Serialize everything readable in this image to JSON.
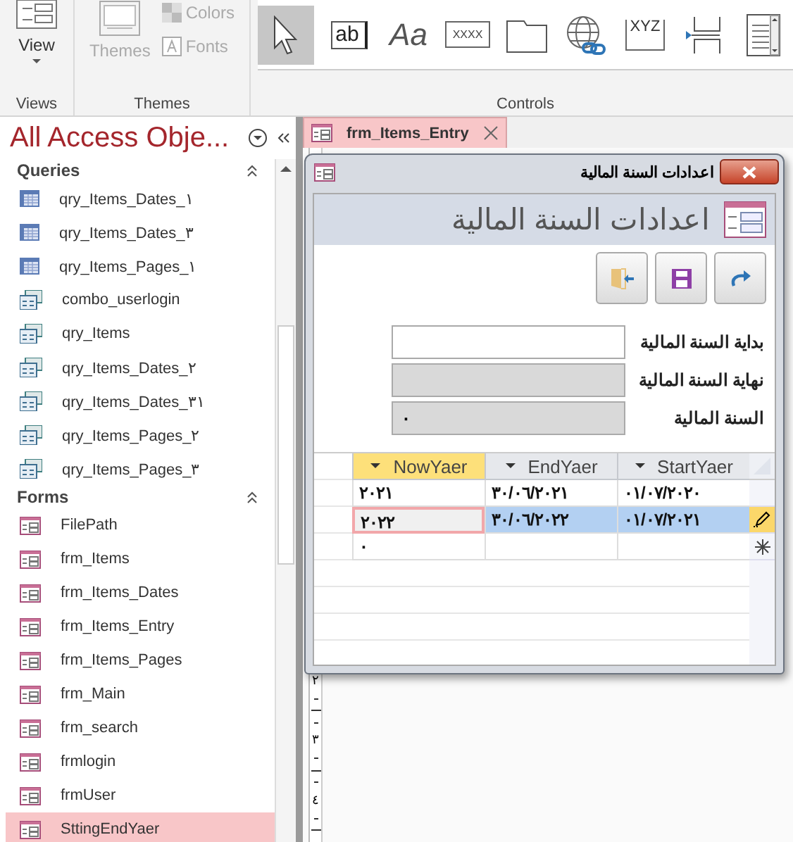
{
  "ribbon": {
    "views_group": {
      "label": "Views",
      "view_button": {
        "label": "View"
      }
    },
    "themes_group": {
      "label": "Themes",
      "themes_button": {
        "label": "Themes",
        "disabled": true
      },
      "colors_button": {
        "label": "Colors",
        "disabled": true
      },
      "fonts_button": {
        "label": "Fonts",
        "disabled": true
      }
    },
    "controls_group": {
      "label": "Controls",
      "tools": {
        "pointer": {
          "selected": true
        },
        "textbox": {
          "glyph": "ab",
          "selected": false
        },
        "label": {
          "glyph": "Aa",
          "selected": false
        },
        "button": {
          "glyph": "XXXX",
          "selected": false
        },
        "tab": {
          "selected": false
        },
        "hyperlink": {
          "selected": false
        },
        "frame": {
          "glyph": "XYZ",
          "selected": false
        },
        "pagebreak": {
          "selected": false
        },
        "listbox": {
          "selected": false
        }
      }
    }
  },
  "nav": {
    "title": "All Access Obje...",
    "groups": [
      {
        "label": "Queries",
        "items": [
          {
            "label": "qry_Items_Dates_١",
            "kind": "grid",
            "selected": false
          },
          {
            "label": "qry_Items_Dates_٣",
            "kind": "grid",
            "selected": false
          },
          {
            "label": "qry_Items_Pages_١",
            "kind": "grid",
            "selected": false
          },
          {
            "label": "combo_userlogin",
            "kind": "query",
            "selected": false
          },
          {
            "label": "qry_Items",
            "kind": "query",
            "selected": false
          },
          {
            "label": "qry_Items_Dates_٢",
            "kind": "query",
            "selected": false
          },
          {
            "label": "qry_Items_Dates_٣١",
            "kind": "query",
            "selected": false
          },
          {
            "label": "qry_Items_Pages_٢",
            "kind": "query",
            "selected": false
          },
          {
            "label": "qry_Items_Pages_٣",
            "kind": "query",
            "selected": false
          }
        ]
      },
      {
        "label": "Forms",
        "items": [
          {
            "label": "FilePath",
            "kind": "form",
            "selected": false
          },
          {
            "label": "frm_Items",
            "kind": "form",
            "selected": false
          },
          {
            "label": "frm_Items_Dates",
            "kind": "form",
            "selected": false
          },
          {
            "label": "frm_Items_Entry",
            "kind": "form",
            "selected": false
          },
          {
            "label": "frm_Items_Pages",
            "kind": "form",
            "selected": false
          },
          {
            "label": "frm_Main",
            "kind": "form",
            "selected": false
          },
          {
            "label": "frm_search",
            "kind": "form",
            "selected": false
          },
          {
            "label": "frmlogin",
            "kind": "form",
            "selected": false
          },
          {
            "label": "frmUser",
            "kind": "form",
            "selected": false
          },
          {
            "label": "SttingEndYaer",
            "kind": "form",
            "selected": true
          }
        ]
      }
    ]
  },
  "document_tab": {
    "label": "frm_Items_Entry",
    "selected": true
  },
  "dialog": {
    "title": "اعدادات السنة المالية",
    "header": "اعدادات السنة المالية",
    "buttons": [
      {
        "kind": "redo"
      },
      {
        "kind": "save"
      },
      {
        "kind": "exit"
      }
    ],
    "fields": [
      {
        "label": "بداية السنة المالية",
        "disabled": false
      },
      {
        "label": "نهاية السنة المالية",
        "disabled": true
      },
      {
        "label": "السنة المالية",
        "value": "٠",
        "disabled": true
      }
    ],
    "table": {
      "columns": [
        {
          "label": "StartYaer",
          "selected": false
        },
        {
          "label": "EndYaer",
          "selected": false
        },
        {
          "label": "NowYaer",
          "selected": true
        }
      ],
      "rows": [
        {
          "kind": "record",
          "selected": false,
          "cells": [
            "٠١/٠٧/٢٠٢٠",
            "٣٠/٠٦/٢٠٢١",
            "٢٠٢١"
          ]
        },
        {
          "kind": "record",
          "selected": true,
          "cells": [
            "٠١/٠٧/٢٠٢١",
            "٣٠/٠٦/٢٠٢٢",
            "٢٠٢٢"
          ]
        },
        {
          "kind": "new",
          "selected": false,
          "cells": [
            null,
            null,
            "٠"
          ]
        }
      ]
    }
  },
  "ruler": [
    "٢",
    "٣",
    "٤"
  ]
}
